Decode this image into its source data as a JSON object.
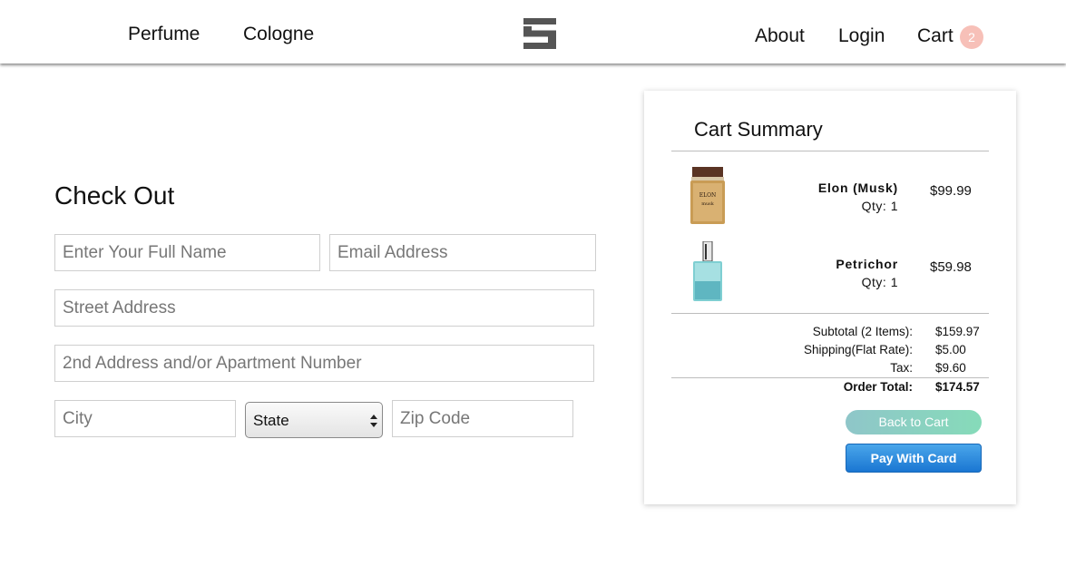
{
  "header": {
    "nav_left": [
      "Perfume",
      "Cologne"
    ],
    "nav_right": {
      "about": "About",
      "login": "Login",
      "cart": "Cart"
    },
    "cart_count": "2",
    "logo_icon": "stacked-bars-logo-icon",
    "badge_color": "#f7c0b8"
  },
  "checkout": {
    "title": "Check Out",
    "fields": {
      "full_name": "Enter Your Full Name",
      "email": "Email Address",
      "street": "Street Address",
      "street2": "2nd Address and/or Apartment Number",
      "city": "City",
      "state": "State",
      "zip": "Zip Code"
    }
  },
  "cart_summary": {
    "title": "Cart Summary",
    "items": [
      {
        "name": "Elon (Musk)",
        "qty": "Qty: 1",
        "price": "$99.99",
        "icon": "amber-perfume-bottle-icon"
      },
      {
        "name": "Petrichor",
        "qty": "Qty: 1",
        "price": "$59.98",
        "icon": "teal-perfume-bottle-icon"
      }
    ],
    "totals": [
      {
        "label": "Subtotal (2 Items):",
        "value": "$159.97"
      },
      {
        "label": "Shipping(Flat Rate):",
        "value": "$5.00"
      },
      {
        "label": "Tax:",
        "value": "$9.60"
      },
      {
        "label": "Order Total:",
        "value": "$174.57"
      }
    ],
    "buttons": {
      "back": "Back to Cart",
      "pay": "Pay With Card"
    },
    "colors": {
      "back_button": "#8fc6c9",
      "pay_button": "#1a76d2"
    }
  }
}
